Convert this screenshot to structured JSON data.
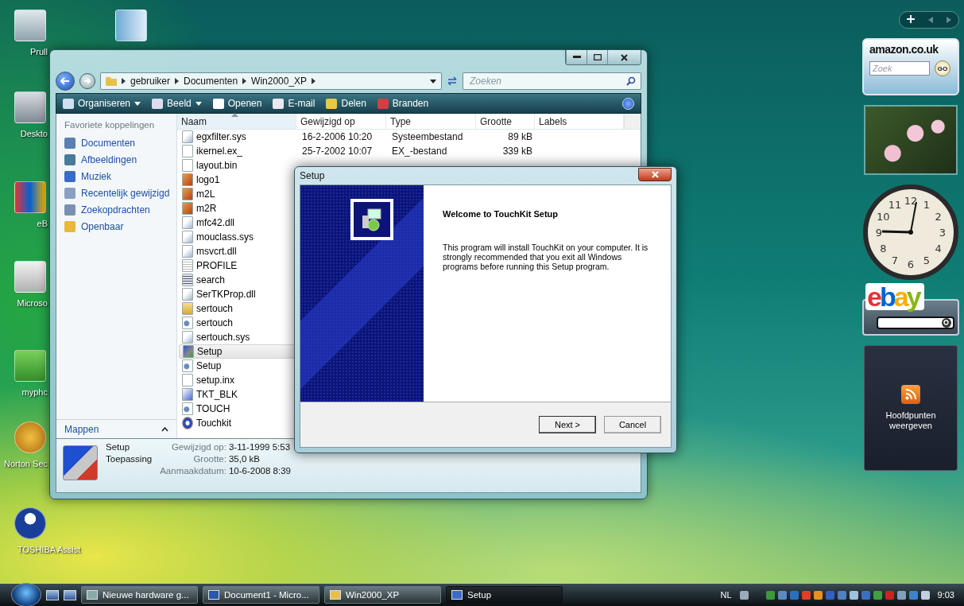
{
  "desktop_icons": [
    {
      "kind": "recycle-bin",
      "label": "Prull"
    },
    {
      "kind": "folder-shortcut"
    },
    {
      "kind": "phone-shortcut",
      "label": "Deskto"
    },
    {
      "kind": "ebay-shortcut",
      "label": "eB"
    },
    {
      "kind": "gear-shortcut",
      "label": "Microso"
    },
    {
      "kind": "leaf-shortcut",
      "label": "myphc"
    },
    {
      "kind": "globe-shortcut",
      "label": "Norton Sec"
    },
    {
      "kind": "user-shortcut",
      "label": "TOSHIBA Assist"
    }
  ],
  "explorer": {
    "breadcrumb": [
      "gebruiker",
      "Documenten",
      "Win2000_XP"
    ],
    "search": {
      "placeholder": "Zoeken"
    },
    "toolbar": [
      {
        "label": "Organiseren",
        "kind": "organize",
        "dropdown": true
      },
      {
        "label": "Beeld",
        "kind": "views",
        "dropdown": true
      },
      {
        "label": "Openen",
        "kind": "open",
        "dropdown": false
      },
      {
        "label": "E-mail",
        "kind": "email",
        "dropdown": false
      },
      {
        "label": "Delen",
        "kind": "share",
        "dropdown": false
      },
      {
        "label": "Branden",
        "kind": "burn",
        "dropdown": false
      }
    ],
    "nav": {
      "heading": "Favoriete koppelingen",
      "items": [
        {
          "label": "Documenten",
          "kind": "documents"
        },
        {
          "label": "Afbeeldingen",
          "kind": "pictures"
        },
        {
          "label": "Muziek",
          "kind": "music"
        },
        {
          "label": "Recentelijk gewijzigd",
          "kind": "recent"
        },
        {
          "label": "Zoekopdrachten",
          "kind": "searches"
        },
        {
          "label": "Openbaar",
          "kind": "public"
        }
      ],
      "folders": "Mappen"
    },
    "columns": [
      {
        "label": "Naam",
        "sorted": true
      },
      {
        "label": "Gewijzigd op",
        "sorted": false
      },
      {
        "label": "Type",
        "sorted": false
      },
      {
        "label": "Grootte",
        "sorted": false
      },
      {
        "label": "Labels",
        "sorted": false
      }
    ],
    "files": [
      {
        "name": "egxfilter.sys",
        "kind": "system",
        "modified": "16-2-2006 10:20",
        "type": "Systeembestand",
        "size": "89 kB",
        "selected": false
      },
      {
        "name": "ikernel.ex_",
        "kind": "blank",
        "modified": "25-7-2002 10:07",
        "type": "EX_-bestand",
        "size": "339 kB",
        "selected": false
      },
      {
        "name": "layout.bin",
        "kind": "blank",
        "selected": false
      },
      {
        "name": "logo1",
        "kind": "image",
        "selected": false
      },
      {
        "name": "m2L",
        "kind": "image",
        "selected": false
      },
      {
        "name": "m2R",
        "kind": "image",
        "selected": false
      },
      {
        "name": "mfc42.dll",
        "kind": "system",
        "selected": false
      },
      {
        "name": "mouclass.sys",
        "kind": "system",
        "selected": false
      },
      {
        "name": "msvcrt.dll",
        "kind": "system",
        "selected": false
      },
      {
        "name": "PROFILE",
        "kind": "text",
        "selected": false
      },
      {
        "name": "search",
        "kind": "list",
        "selected": false
      },
      {
        "name": "SerTKProp.dll",
        "kind": "system",
        "selected": false
      },
      {
        "name": "sertouch",
        "kind": "folder",
        "selected": false
      },
      {
        "name": "sertouch",
        "kind": "config",
        "selected": false
      },
      {
        "name": "sertouch.sys",
        "kind": "system",
        "selected": false
      },
      {
        "name": "Setup",
        "kind": "installer",
        "selected": true
      },
      {
        "name": "Setup",
        "kind": "config",
        "selected": false
      },
      {
        "name": "setup.inx",
        "kind": "blank",
        "selected": false
      },
      {
        "name": "TKT_BLK",
        "kind": "picture",
        "selected": false
      },
      {
        "name": "TOUCH",
        "kind": "config",
        "selected": false
      },
      {
        "name": "Touchkit",
        "kind": "disc",
        "selected": false
      }
    ],
    "details": {
      "name": "Setup",
      "type": "Toepassing",
      "fields": [
        {
          "label": "Gewijzigd op:",
          "value": "3-11-1999 5:53"
        },
        {
          "label": "Grootte:",
          "value": "35,0 kB"
        },
        {
          "label": "Aanmaakdatum:",
          "value": "10-6-2008 8:39"
        }
      ]
    }
  },
  "setup_dialog": {
    "title": "Setup",
    "heading": "Welcome to TouchKit Setup",
    "body": "This program will install TouchKit on your computer.  It is strongly recommended that you exit all Windows programs before running this Setup program.",
    "buttons": [
      {
        "label": "Next >",
        "default": true
      },
      {
        "label": "Cancel",
        "default": false
      }
    ]
  },
  "sidebar": {
    "amazon": {
      "logo": "amazon.co.uk",
      "search_placeholder": "Zoek",
      "button": "GO"
    },
    "clock": {
      "numerals": [
        "12",
        "11",
        "1",
        "10",
        "2",
        "9",
        "3",
        "8",
        "4",
        "7",
        "5",
        "6"
      ]
    },
    "ebay": {
      "logo": "ebay"
    },
    "feed": {
      "label": "Hoofdpunten weergeven"
    }
  },
  "taskbar": {
    "tasks": [
      {
        "label": "Nieuwe hardware g...",
        "kind": "hardware",
        "selected": false
      },
      {
        "label": "Document1 - Micro...",
        "kind": "word",
        "selected": false
      },
      {
        "label": "Win2000_XP",
        "kind": "folder",
        "selected": false
      },
      {
        "label": "Setup",
        "kind": "setup",
        "selected": true
      }
    ],
    "language": "NL",
    "time": "9:03"
  }
}
